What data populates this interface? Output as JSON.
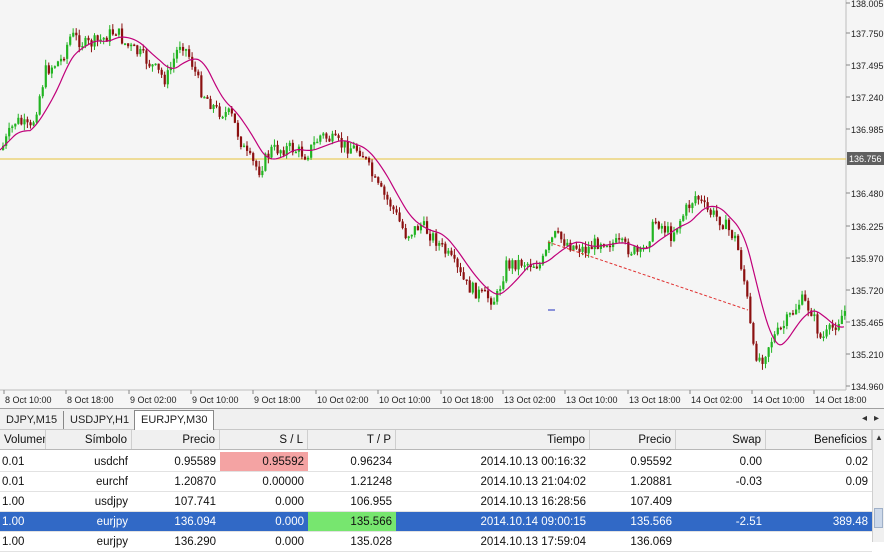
{
  "chart": {
    "line_color": "#c0007a",
    "bull_color": "#22b422",
    "bear_color": "#8b1010",
    "hline_color": "#e8c23a",
    "price_labels": [
      "138.005",
      "137.750",
      "137.495",
      "137.240",
      "136.985",
      "136.480",
      "136.225",
      "135.970",
      "135.720",
      "135.465",
      "135.210",
      "134.960"
    ],
    "current_price_label": "136.756",
    "time_labels": [
      "8 Oct 10:00",
      "8 Oct 18:00",
      "9 Oct 02:00",
      "9 Oct 10:00",
      "9 Oct 18:00",
      "10 Oct 02:00",
      "10 Oct 10:00",
      "10 Oct 18:00",
      "13 Oct 02:00",
      "13 Oct 10:00",
      "13 Oct 18:00",
      "14 Oct 02:00",
      "14 Oct 10:00",
      "14 Oct 18:00"
    ]
  },
  "tabs": [
    {
      "label": "DJPY,M15"
    },
    {
      "label": "USDJPY,H1"
    },
    {
      "label": "EURJPY,M30"
    }
  ],
  "table": {
    "headers": {
      "volumen": "Volumen",
      "simbolo": "Símbolo",
      "precio": "Precio",
      "sl": "S / L",
      "tp": "T / P",
      "tiempo": "Tiempo",
      "precio2": "Precio",
      "swap": "Swap",
      "beneficios": "Beneficios"
    },
    "rows": [
      {
        "volumen": "0.01",
        "simbolo": "usdchf",
        "precio": "0.95589",
        "sl": "0.95592",
        "tp": "0.96234",
        "tiempo": "2014.10.13 00:16:32",
        "precio2": "0.95592",
        "swap": "0.00",
        "beneficios": "0.02"
      },
      {
        "volumen": "0.01",
        "simbolo": "eurchf",
        "precio": "1.20870",
        "sl": "0.00000",
        "tp": "1.21248",
        "tiempo": "2014.10.13 21:04:02",
        "precio2": "1.20881",
        "swap": "-0.03",
        "beneficios": "0.09"
      },
      {
        "volumen": "1.00",
        "simbolo": "usdjpy",
        "precio": "107.741",
        "sl": "0.000",
        "tp": "106.955",
        "tiempo": "2014.10.13 16:28:56",
        "precio2": "107.409",
        "swap": "",
        "beneficios": ""
      },
      {
        "volumen": "1.00",
        "simbolo": "eurjpy",
        "precio": "136.094",
        "sl": "0.000",
        "tp": "135.566",
        "tiempo": "2014.10.14 09:00:15",
        "precio2": "135.566",
        "swap": "-2.51",
        "beneficios": "389.48"
      },
      {
        "volumen": "1.00",
        "simbolo": "eurjpy",
        "precio": "136.290",
        "sl": "0.000",
        "tp": "135.028",
        "tiempo": "2014.10.13 17:59:04",
        "precio2": "136.069",
        "swap": "",
        "beneficios": ""
      }
    ]
  }
}
